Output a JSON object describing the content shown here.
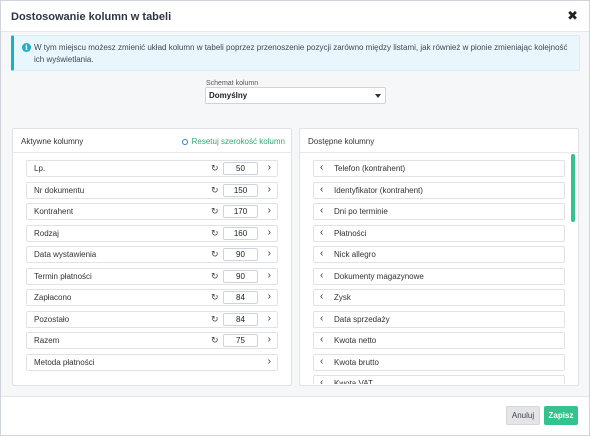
{
  "dialog": {
    "title": "Dostosowanie kolumn w tabeli",
    "close": "✖"
  },
  "info": {
    "icon": "info-icon",
    "text": "W tym miejscu możesz zmienić układ kolumn w tabeli poprzez przenoszenie pozycji zarówno między listami, jak również w pionie zmieniając kolejność ich wyświetlania."
  },
  "schema": {
    "label": "Schemat kolumn",
    "value": "Domyślny"
  },
  "active": {
    "title": "Aktywne kolumny",
    "reset_label": "Resetuj szerokość kolumn",
    "items": [
      {
        "label": "Lp.",
        "width": "50"
      },
      {
        "label": "Nr dokumentu",
        "width": "150"
      },
      {
        "label": "Kontrahent",
        "width": "170"
      },
      {
        "label": "Rodzaj",
        "width": "160"
      },
      {
        "label": "Data wystawienia",
        "width": "90"
      },
      {
        "label": "Termin płatności",
        "width": "90"
      },
      {
        "label": "Zapłacono",
        "width": "84"
      },
      {
        "label": "Pozostało",
        "width": "84"
      },
      {
        "label": "Razem",
        "width": "75"
      },
      {
        "label": "Metoda płatności",
        "width": null
      }
    ]
  },
  "available": {
    "title": "Dostępne kolumny",
    "items": [
      "Telefon (kontrahent)",
      "Identyfikator (kontrahent)",
      "Dni po terminie",
      "Płatności",
      "Nick allegro",
      "Dokumenty magazynowe",
      "Zysk",
      "Data sprzedaży",
      "Kwota netto",
      "Kwota brutto",
      "Kwota VAT"
    ]
  },
  "footer": {
    "cancel_label": "Anuluj",
    "save_label": "Zapisz"
  },
  "colors": {
    "accent_green": "#34c38f",
    "info_blue": "#1ab0cb",
    "reset_link": "#2eaa73"
  }
}
